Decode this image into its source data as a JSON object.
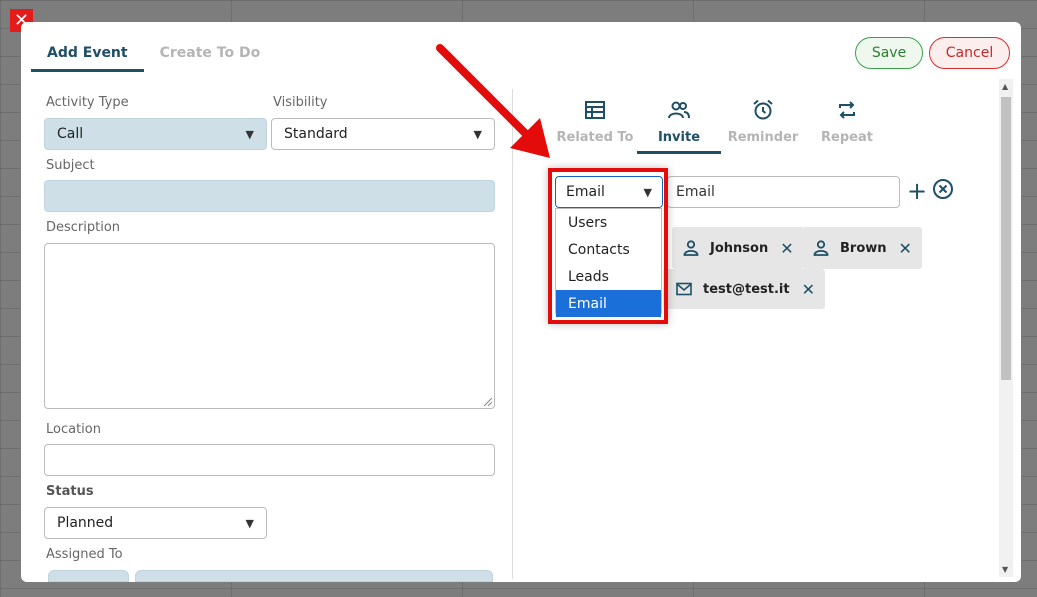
{
  "tabs": [
    {
      "label": "Add Event",
      "active": true
    },
    {
      "label": "Create To Do",
      "active": false
    }
  ],
  "buttons": {
    "save": "Save",
    "cancel": "Cancel"
  },
  "form": {
    "activity_type_label": "Activity Type",
    "activity_type_value": "Call",
    "visibility_label": "Visibility",
    "visibility_value": "Standard",
    "subject_label": "Subject",
    "description_label": "Description",
    "location_label": "Location",
    "status_label": "Status",
    "status_value": "Planned",
    "assigned_to_label": "Assigned To"
  },
  "right_tabs": [
    {
      "label": "Related To",
      "icon": "table-icon",
      "active": false
    },
    {
      "label": "Invite",
      "icon": "people-icon",
      "active": true
    },
    {
      "label": "Reminder",
      "icon": "alarm-icon",
      "active": false
    },
    {
      "label": "Repeat",
      "icon": "repeat-icon",
      "active": false
    }
  ],
  "invite": {
    "type_value": "Email",
    "input_value": "Email",
    "options": [
      "Users",
      "Contacts",
      "Leads",
      "Email"
    ],
    "selected_option": "Email",
    "chips": [
      {
        "label": "Johnson",
        "icon": "person-icon"
      },
      {
        "label": "Brown",
        "icon": "person-icon"
      },
      {
        "label": "test@test.it",
        "icon": "mail-icon"
      }
    ]
  },
  "colors": {
    "accent": "#1f4f66",
    "highlight_red": "#e40b0b",
    "selected_blue": "#1a6fd8",
    "save_green": "#3aa14a",
    "cancel_red": "#e02b2b"
  }
}
